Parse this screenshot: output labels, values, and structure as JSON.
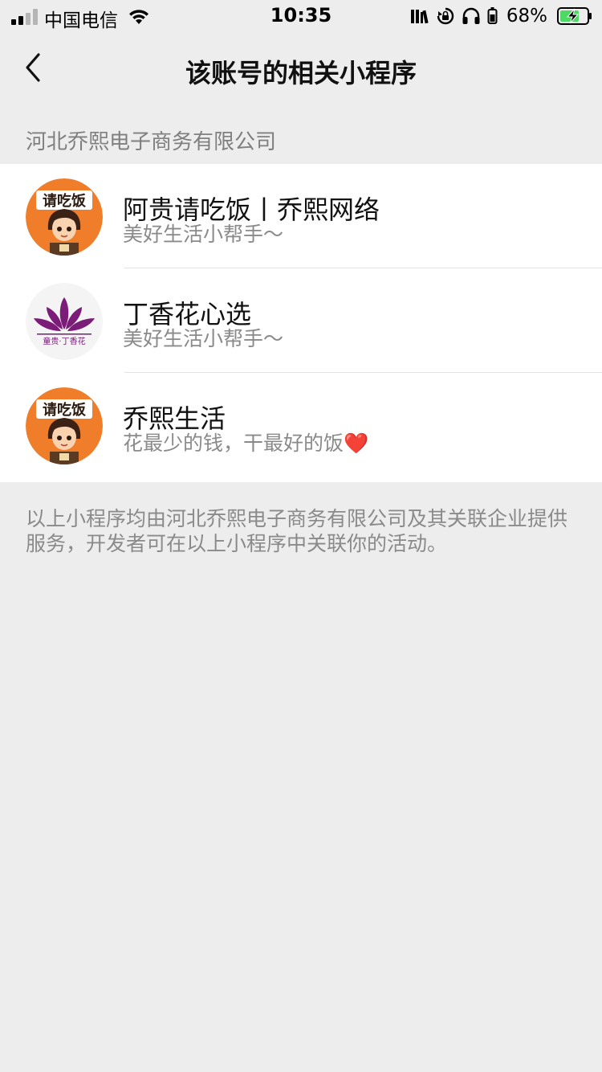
{
  "status_bar": {
    "carrier": "中国电信",
    "time": "10:35",
    "battery": "68%"
  },
  "nav": {
    "title": "该账号的相关小程序"
  },
  "company": "河北乔熙电子商务有限公司",
  "mini_programs": [
    {
      "title": "阿贵请吃饭丨乔熙网络",
      "desc": "美好生活小帮手～",
      "avatar": "qingchifan-logo",
      "avatar_text": "请吃饭"
    },
    {
      "title": "丁香花心选",
      "desc": "美好生活小帮手～",
      "avatar": "clove-flower-logo",
      "avatar_text": "童贵·丁香花"
    },
    {
      "title": "乔熙生活",
      "desc": "花最少的钱，干最好的饭❤️",
      "avatar": "qingchifan-logo",
      "avatar_text": "请吃饭"
    }
  ],
  "footer_note": "以上小程序均由河北乔熙电子商务有限公司及其关联企业提供服务，开发者可在以上小程序中关联你的活动。",
  "colors": {
    "background": "#ededed",
    "avatar_orange": "#f07d2a",
    "clove_purple": "#7a1c78"
  }
}
